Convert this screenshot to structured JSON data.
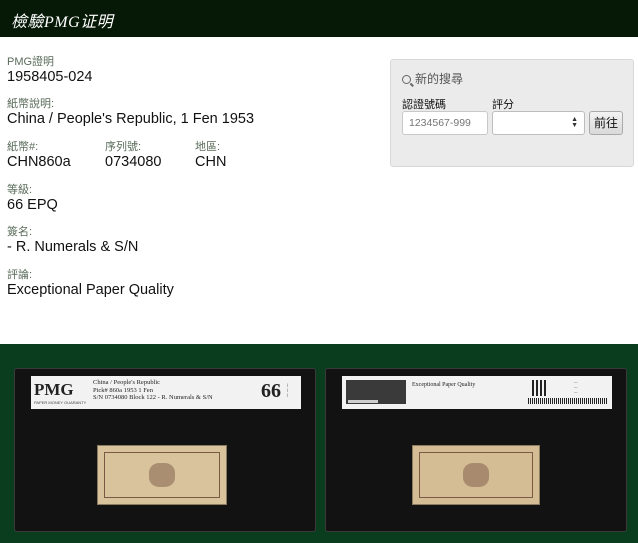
{
  "header": {
    "title": "檢驗PMG证明"
  },
  "certificate": {
    "cert_label": "PMG證明",
    "cert_value": "1958405-024",
    "desc_label": "紙幣說明:",
    "desc_value": "China / People's Republic, 1 Fen 1953",
    "note_no_label": "紙幣#:",
    "note_no_value": "CHN860a",
    "serial_label": "序列號:",
    "serial_value": "0734080",
    "region_label": "地區:",
    "region_value": "CHN",
    "grade_label": "等級:",
    "grade_value": "66 EPQ",
    "sign_label": "簽名:",
    "sign_value": "- R. Numerals & S/N",
    "comment_label": "評論:",
    "comment_value": "Exceptional Paper Quality"
  },
  "search": {
    "title": "新的搜尋",
    "cert_label": "認證號碼",
    "grade_label": "評分",
    "cert_placeholder": "1234567-999",
    "grade_selected": "",
    "go_label": "前往"
  },
  "images": {
    "front": {
      "logo": "PMG",
      "logo_sub": "PAPER MONEY GUARANTY",
      "line1": "China / People's Republic",
      "line2": "Pick# 860a   1953   1 Fen",
      "line3": "S/N 0734080 Block 122 - R. Numerals & S/N",
      "grade": "66"
    },
    "back": {
      "comment": "Exceptional Paper Quality"
    }
  },
  "colors": {
    "topbar": "#061906",
    "image_band": "#0a3d1e",
    "search_panel": "#ecebec"
  }
}
